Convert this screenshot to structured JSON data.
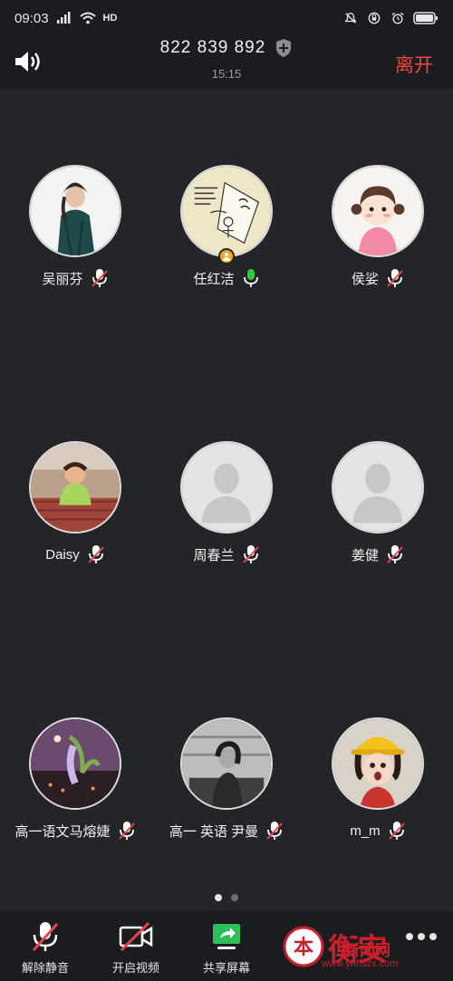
{
  "status_bar": {
    "time": "09:03",
    "network": "4G",
    "hd": "HD"
  },
  "header": {
    "meeting_id": "822 839 892",
    "elapsed": "15:15",
    "leave_label": "离开"
  },
  "participants": [
    {
      "name": "吴丽芬",
      "mic": "muted",
      "avatar": "photo-woman-hat"
    },
    {
      "name": "任红洁",
      "mic": "active",
      "avatar": "illustration-sketch",
      "host": true
    },
    {
      "name": "侯娑",
      "mic": "muted",
      "avatar": "cartoon-girl"
    },
    {
      "name": "Daisy",
      "mic": "muted",
      "avatar": "photo-child"
    },
    {
      "name": "周春兰",
      "mic": "muted",
      "avatar": "default-silhouette"
    },
    {
      "name": "姜健",
      "mic": "muted",
      "avatar": "default-silhouette"
    },
    {
      "name": "高一语文马熔婕",
      "mic": "muted",
      "avatar": "photo-flowers"
    },
    {
      "name": "高一 英语 尹曼",
      "mic": "muted",
      "avatar": "photo-bw-woman"
    },
    {
      "name": "m_m",
      "mic": "muted",
      "avatar": "cartoon-yellow-hat"
    }
  ],
  "pager": {
    "pages": 2,
    "current": 1
  },
  "toolbar": {
    "unmute_label": "解除静音",
    "video_label": "开启视频",
    "share_label": "共享屏幕"
  },
  "watermark": {
    "brand": "衡安",
    "sub": "新闻网",
    "url": "www.ynhszx.com",
    "seal": "本"
  },
  "colors": {
    "background": "#232529",
    "bar": "#1b1c1f",
    "leave": "#f04a3e",
    "mic_active": "#2ecc40",
    "mic_muted": "#e8454a",
    "share_green": "#2fbf5a",
    "host_badge": "#f5a623"
  }
}
